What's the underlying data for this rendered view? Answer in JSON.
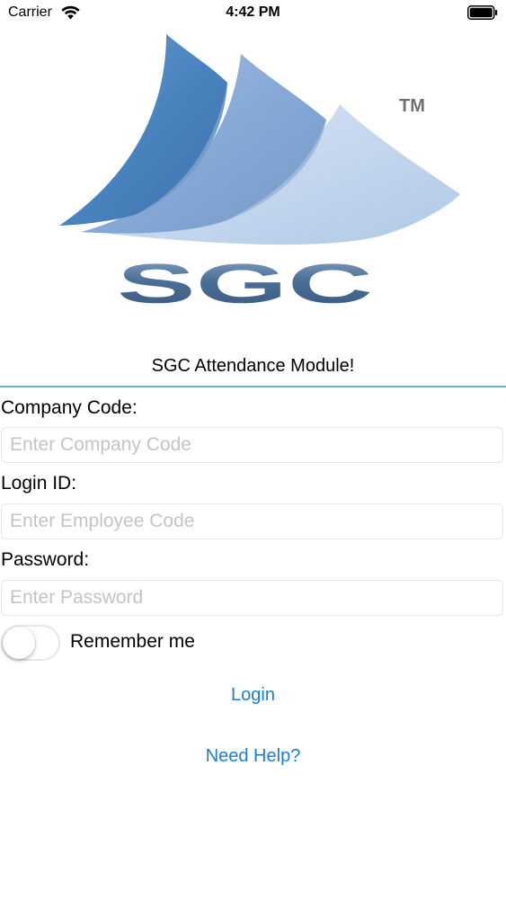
{
  "status_bar": {
    "carrier": "Carrier",
    "time": "4:42 PM",
    "wifi_icon": "wifi-icon",
    "battery_icon": "battery-icon"
  },
  "logo": {
    "text": "SGC",
    "trademark": "TM",
    "colors": {
      "sail_dark": "#4a83bf",
      "sail_mid": "#86a9d6",
      "sail_light": "#c4d7ee",
      "lettering": "#4b6f97"
    }
  },
  "app_title": "SGC Attendance Module!",
  "form": {
    "company_code": {
      "label": "Company Code:",
      "value": "",
      "placeholder": "Enter Company Code"
    },
    "login_id": {
      "label": "Login ID:",
      "value": "",
      "placeholder": "Enter Employee Code"
    },
    "password": {
      "label": "Password:",
      "value": "",
      "placeholder": "Enter Password"
    },
    "remember_me": {
      "label": "Remember me",
      "checked": false
    }
  },
  "actions": {
    "login_label": "Login",
    "help_label": "Need Help?"
  },
  "colors": {
    "link": "#1a7fd1",
    "divider": "#6fb0b8"
  }
}
